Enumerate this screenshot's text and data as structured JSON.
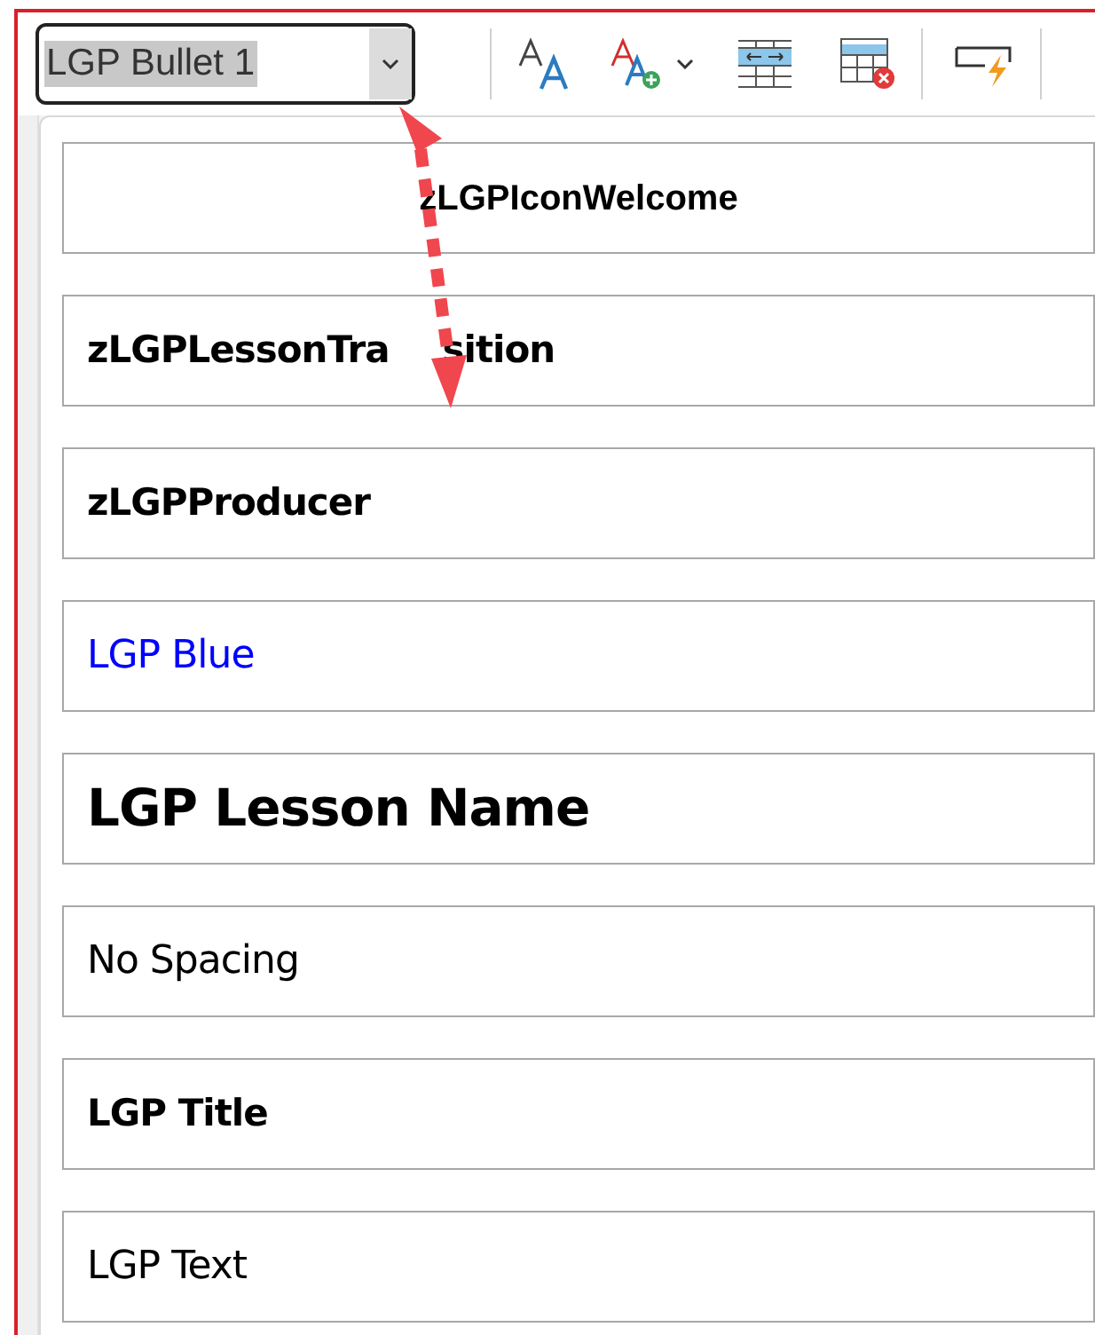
{
  "style_box": {
    "value": "LGP Bullet 1",
    "selected": true
  },
  "styles": [
    {
      "name": "zLGPIconWelcome",
      "kind": "centered",
      "color": "#000000"
    },
    {
      "name": "zLGPLessonTra",
      "name_after_arrow": "sition",
      "kind": "bold",
      "color": "#000000"
    },
    {
      "name": "zLGPProducer",
      "kind": "bold",
      "color": "#000000"
    },
    {
      "name": "LGP Blue",
      "kind": "normal",
      "color": "#0000ff"
    },
    {
      "name": "LGP Lesson Name",
      "kind": "heading",
      "color": "#000000"
    },
    {
      "name": "No Spacing",
      "kind": "normal",
      "color": "#000000"
    },
    {
      "name": "LGP Title",
      "kind": "bold",
      "color": "#000000"
    },
    {
      "name": "LGP Text",
      "kind": "normal",
      "color": "#000000"
    }
  ]
}
